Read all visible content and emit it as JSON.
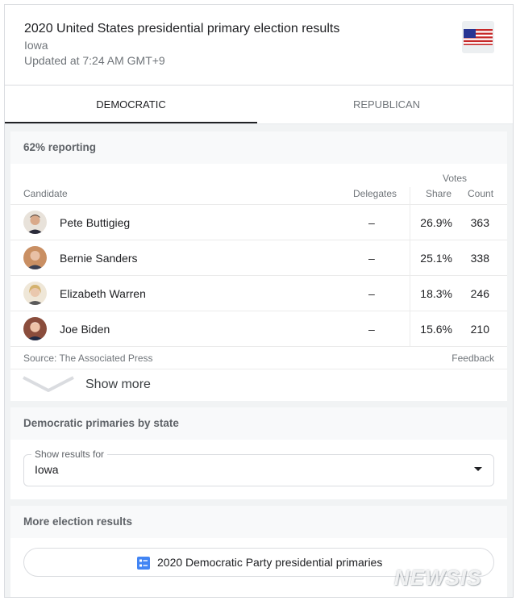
{
  "header": {
    "title": "2020 United States presidential primary election results",
    "subtitle": "Iowa",
    "updated": "Updated at 7:24 AM GMT+9",
    "flag_icon": "us-flag-icon"
  },
  "tabs": [
    {
      "label": "DEMOCRATIC",
      "active": true
    },
    {
      "label": "REPUBLICAN",
      "active": false
    }
  ],
  "results": {
    "reporting": "62% reporting",
    "columns": {
      "votes_group": "Votes",
      "candidate": "Candidate",
      "delegates": "Delegates",
      "share": "Share",
      "count": "Count"
    },
    "rows": [
      {
        "name": "Pete Buttigieg",
        "delegates": "–",
        "share": "26.9%",
        "count": "363",
        "avatar_bg": "#8d6e63"
      },
      {
        "name": "Bernie Sanders",
        "delegates": "–",
        "share": "25.1%",
        "count": "338",
        "avatar_bg": "#b0774f"
      },
      {
        "name": "Elizabeth Warren",
        "delegates": "–",
        "share": "18.3%",
        "count": "246",
        "avatar_bg": "#d8b880"
      },
      {
        "name": "Joe Biden",
        "delegates": "–",
        "share": "15.6%",
        "count": "210",
        "avatar_bg": "#7a4a3a"
      }
    ],
    "source": "Source: The Associated Press",
    "feedback": "Feedback",
    "show_more": "Show more"
  },
  "by_state": {
    "title": "Democratic primaries by state",
    "select_caption": "Show results for",
    "select_value": "Iowa"
  },
  "more_results": {
    "title": "More election results",
    "link_label": "2020 Democratic Party presidential primaries",
    "link_icon": "ballot-list-icon"
  },
  "watermark": "NEWSIS",
  "colors": {
    "accent_icon": "#4285f4",
    "tab_indicator": "#202124",
    "panel_header_bg": "#f8f9fa",
    "page_bg": "#f1f3f4"
  }
}
